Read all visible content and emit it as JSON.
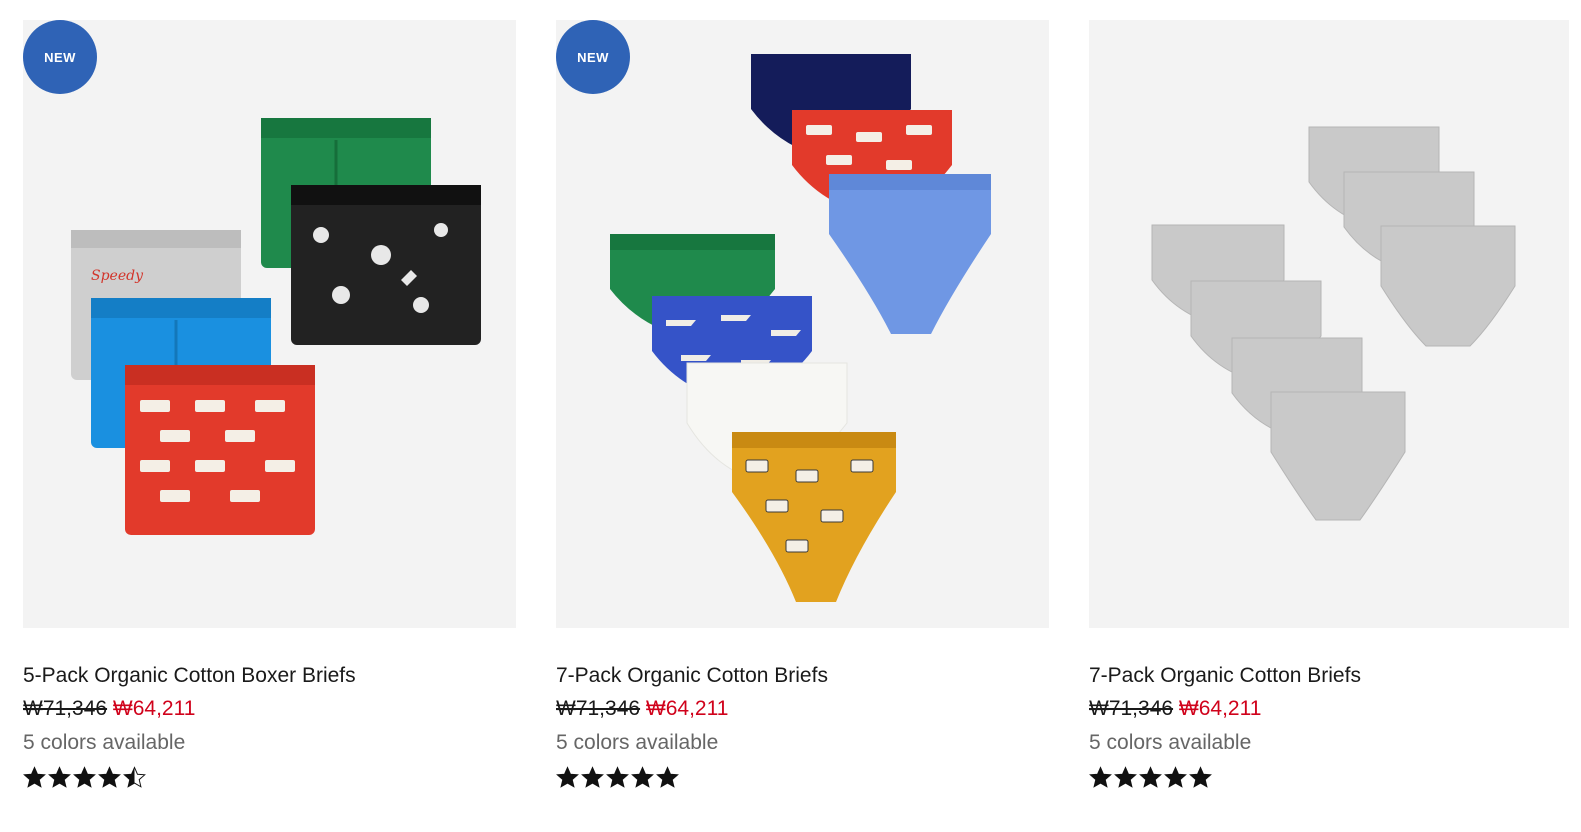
{
  "products": [
    {
      "badge": "NEW",
      "title": "5-Pack Organic Cotton Boxer Briefs",
      "price_original": "₩71,346",
      "price_sale": "₩64,211",
      "colors_text": "5 colors available",
      "rating": 4.5,
      "image_alt": "boxer-briefs-5-pack",
      "swatches": [
        "#1f8a4c",
        "#1e1e1e",
        "#cfcfcf",
        "#1a90e0",
        "#e23a2b"
      ]
    },
    {
      "badge": "NEW",
      "title": "7-Pack Organic Cotton Briefs",
      "price_original": "₩71,346",
      "price_sale": "₩64,211",
      "colors_text": "5 colors available",
      "rating": 5,
      "image_alt": "briefs-7-pack-colors",
      "swatches": [
        "#141c5a",
        "#e23a2b",
        "#6f97e4",
        "#1f8a4c",
        "#3553c8",
        "#f7f7f4",
        "#e2a21f"
      ]
    },
    {
      "badge": "",
      "title": "7-Pack Organic Cotton Briefs",
      "price_original": "₩71,346",
      "price_sale": "₩64,211",
      "colors_text": "5 colors available",
      "rating": 5,
      "image_alt": "briefs-7-pack-grey",
      "swatches": [
        "#c9c9c9"
      ]
    }
  ],
  "colors": {
    "badge_bg": "#2f63b6",
    "sale_price": "#d0021b",
    "image_bg": "#f3f3f3"
  }
}
